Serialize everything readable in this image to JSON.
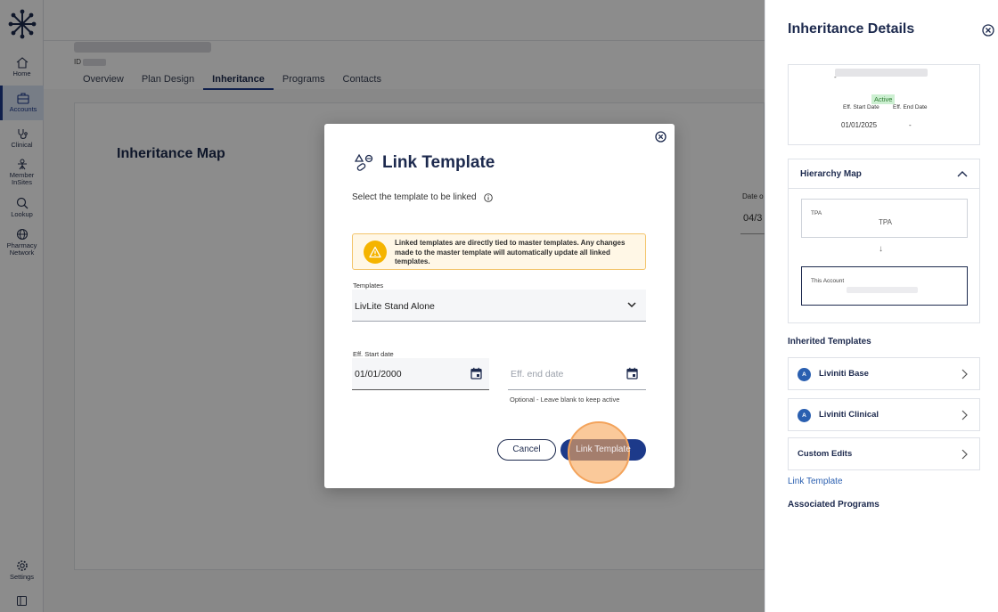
{
  "sidebar": {
    "items": [
      {
        "label": "Home",
        "icon": "home-icon"
      },
      {
        "label": "Accounts",
        "icon": "accounts-icon",
        "active": true
      },
      {
        "label": "Clinical",
        "icon": "clinical-icon"
      },
      {
        "label": "Member InSites",
        "line1": "Member",
        "line2": "InSites",
        "icon": "member-insites-icon"
      },
      {
        "label": "Lookup",
        "icon": "search-icon"
      },
      {
        "label": "Pharmacy Network",
        "line1": "Pharmacy",
        "line2": "Network",
        "icon": "globe-icon"
      },
      {
        "label": "Settings",
        "icon": "gear-icon"
      }
    ],
    "accent": "#1d3a8a"
  },
  "account": {
    "id_label": "ID",
    "tabs": [
      "Overview",
      "Plan Design",
      "Inheritance",
      "Programs",
      "Contacts"
    ],
    "active_tab": "Inheritance"
  },
  "main": {
    "title": "Inheritance Map",
    "date_label": "Date o",
    "date_value": "04/3"
  },
  "panel": {
    "title": "Inheritance Details",
    "summary": {
      "dash_top": "-",
      "status": "Active",
      "start_label": "Eff. Start Date",
      "end_label": "Eff. End Date",
      "start_value": "01/01/2025",
      "end_value": "-"
    },
    "hierarchy": {
      "title": "Hierarchy Map",
      "tpa_small": "TPA",
      "tpa_center": "TPA",
      "arrow": "↓",
      "account_label": "This Account"
    },
    "inherited_title": "Inherited Templates",
    "templates": [
      {
        "avatar": "A",
        "label": "Liviniti Base"
      },
      {
        "avatar": "A",
        "label": "Liviniti Clinical"
      },
      {
        "avatar": "",
        "label": "Custom Edits"
      }
    ],
    "link_text": "Link Template",
    "associated_title": "Associated Programs"
  },
  "modal": {
    "title": "Link Template",
    "subtitle": "Select the template to be linked",
    "warning": "Linked templates are directly tied to master templates. Any changes made to the master template will automatically update all linked templates.",
    "templates_label": "Templates",
    "templates_value": "LivLite Stand Alone",
    "start_label": "Eff. Start date",
    "start_value": "01/01/2000",
    "end_placeholder": "Eff. end date",
    "end_helper": "Optional - Leave blank to keep active",
    "cancel_label": "Cancel",
    "submit_label": "Link Template",
    "warning_color": "#f5b400",
    "primary_color": "#1d3a8a"
  }
}
